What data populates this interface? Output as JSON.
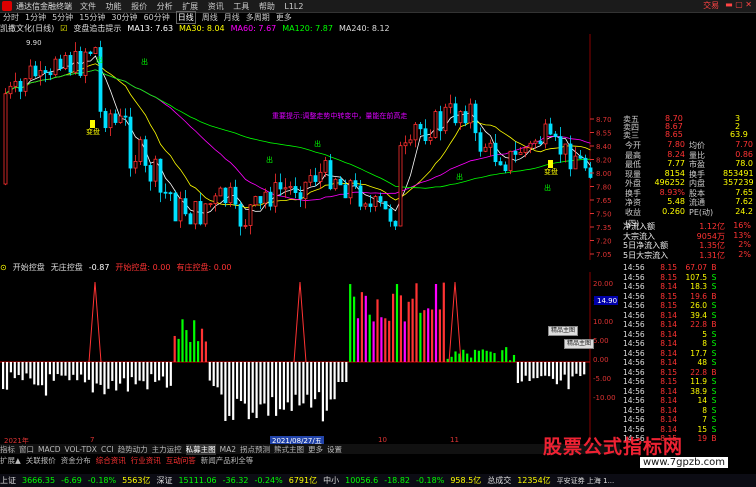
{
  "titlebar": {
    "app": "通达信金融终端",
    "menu": [
      "文件",
      "功能",
      "报价",
      "分析",
      "扩展",
      "资讯",
      "工具",
      "帮助"
    ],
    "right": "交易",
    "extra": "L1L2"
  },
  "periods": {
    "items": [
      "分时",
      "1分钟",
      "5分钟",
      "15分钟",
      "30分钟",
      "60分钟",
      "日线",
      "周线",
      "月线",
      "多周期",
      "更多"
    ],
    "selected": "日线"
  },
  "ma_bar": {
    "stock": "凯撒文化(日线)",
    "label": "变盘追击提示",
    "ma13": "MA13: 7.63",
    "ma30": "MA30: 8.04",
    "ma60": "MA60: 7.67",
    "ma120": "MA120: 7.87",
    "ma240": "MA240: 8.12"
  },
  "chart": {
    "high_label": "9.90",
    "annotation": "重要提示:调整走势中转变中，量能在前高走",
    "signals": [
      "变盘",
      "出",
      "出",
      "出",
      "出",
      "出",
      "变盘",
      "出"
    ],
    "y_ticks": [
      "8.70",
      "8.55",
      "8.40",
      "8.20",
      "8.00",
      "7.80",
      "7.65",
      "7.50",
      "7.35",
      "7.20",
      "7.05"
    ]
  },
  "indicator": {
    "name": "开始控盘",
    "sub": "无庄控盘",
    "val": "-0.87",
    "tag1": "开始控盘: 0.00",
    "tag2": "有庄控盘: 0.00",
    "y_ticks": [
      "20.00",
      "15.00",
      "10.00",
      "5.00",
      "0.00",
      "-5.00",
      "-10.00"
    ],
    "marker": "14.90"
  },
  "buttons": [
    "精品主图",
    "精品主图"
  ],
  "quote": {
    "top": [
      [
        "卖五",
        "8.70",
        ""
      ],
      [
        "卖四",
        "8.67",
        ""
      ],
      [
        "卖三",
        "8.65",
        ""
      ]
    ],
    "rows": [
      [
        "今开",
        "7.80",
        "均价",
        "7.70"
      ],
      [
        "最高",
        "8.24",
        "量比",
        "0.86"
      ],
      [
        "最低",
        "7.77",
        "市盈",
        "78.0"
      ],
      [
        "现量",
        "8154",
        "换手",
        "853491"
      ],
      [
        "外盘",
        "496252",
        "内盘",
        "357239"
      ],
      [
        "换手",
        "8.93%",
        "股本",
        "7.65"
      ],
      [
        "净资",
        "5.48",
        "流通",
        "7.62"
      ],
      [
        "收益(四)",
        "0.260",
        "PE(动)",
        "24.2"
      ]
    ],
    "side": [
      "3",
      "2",
      "63.9"
    ]
  },
  "flows": [
    [
      "净流入额",
      "1.12亿",
      "16%"
    ],
    [
      "大宗流入",
      "9054万",
      "13%"
    ],
    [
      "5日净流入额",
      "1.35亿",
      "2%"
    ],
    [
      "5日大宗流入",
      "1.31亿",
      "2%"
    ]
  ],
  "ticks": [
    [
      "14:56",
      "8.15",
      "67.07",
      "B"
    ],
    [
      "14:56",
      "8.15",
      "107.5",
      "S"
    ],
    [
      "14:56",
      "8.14",
      "18.3",
      "S"
    ],
    [
      "14:56",
      "8.15",
      "19.6",
      "B"
    ],
    [
      "14:56",
      "8.15",
      "26.0",
      "S"
    ],
    [
      "14:56",
      "8.14",
      "39.4",
      "S"
    ],
    [
      "14:56",
      "8.14",
      "22.8",
      "B"
    ],
    [
      "14:56",
      "8.14",
      "5",
      "S"
    ],
    [
      "14:56",
      "8.14",
      "8",
      "S"
    ],
    [
      "14:56",
      "8.14",
      "17.7",
      "S"
    ],
    [
      "14:56",
      "8.14",
      "48",
      "S"
    ],
    [
      "14:56",
      "8.15",
      "22.8",
      "B"
    ],
    [
      "14:56",
      "8.15",
      "11.9",
      "S"
    ],
    [
      "14:56",
      "8.14",
      "38.9",
      "S"
    ],
    [
      "14:56",
      "8.14",
      "14",
      "S"
    ],
    [
      "14:56",
      "8.14",
      "8",
      "S"
    ],
    [
      "14:56",
      "8.14",
      "7",
      "S"
    ],
    [
      "14:56",
      "8.14",
      "15",
      "S"
    ],
    [
      "14:56",
      "8.15",
      "19",
      "B"
    ]
  ],
  "timeline": {
    "left": "2021年",
    "l2": "7",
    "date": "2021/08/27/五",
    "mid": "10",
    "right": "11"
  },
  "tabs": {
    "items": [
      "指标",
      "窗口",
      "MACD",
      "VOL-TDX",
      "CCI",
      "趋势动力",
      "主力运控",
      "私募主图",
      "MA2",
      "拐点预测",
      "熊式主图",
      "更多",
      "设置"
    ],
    "selected": "私募主图"
  },
  "tabs2": {
    "items": [
      "扩展▲",
      "关联报价",
      "资金分布",
      "综合资讯",
      "行业资讯",
      "互动问答",
      "新闻产品利全等"
    ]
  },
  "status": [
    {
      "name": "上证",
      "v": "3666.35",
      "c": "-6.69",
      "p": "-0.18%",
      "a": "5563亿"
    },
    {
      "name": "深证",
      "v": "15111.06",
      "c": "-36.32",
      "p": "-0.24%",
      "a": "6791亿"
    },
    {
      "name": "中小",
      "v": "10056.6",
      "c": "-18.82",
      "p": "-0.18%",
      "a": "958.5亿"
    },
    {
      "name": "总成交",
      "v": "12354亿",
      "c": "",
      "p": "",
      "a": ""
    }
  ],
  "status_extra": "平安证券 上海 1...",
  "watermark": "股票公式指标网",
  "watermark_url": "www.7gpzb.com",
  "colors": {
    "up": "#ff3030",
    "down": "#00e0ff",
    "ma5": "#ffffff",
    "ma10": "#ffff00",
    "ma20": "#ff00ff",
    "ma60": "#00ff00"
  }
}
